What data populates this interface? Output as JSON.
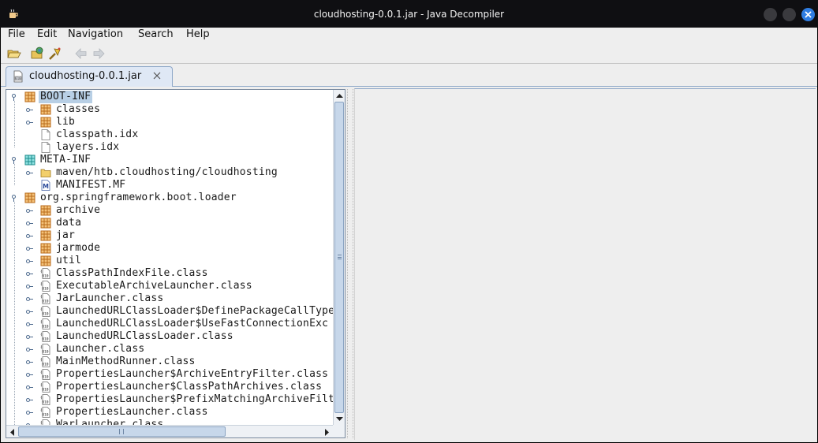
{
  "window": {
    "title": "cloudhosting-0.0.1.jar - Java Decompiler"
  },
  "menu": [
    "File",
    "Edit",
    "Navigation",
    "Search",
    "Help"
  ],
  "toolbar": {
    "icons": [
      "open-file-icon",
      "open-type-icon",
      "search-icon",
      "back-icon",
      "forward-icon"
    ]
  },
  "tab": {
    "label": "cloudhosting-0.0.1.jar"
  },
  "tree": [
    {
      "label": "BOOT-INF",
      "icon": "package",
      "depth": 0,
      "expander": "expanded",
      "selected": true
    },
    {
      "label": "classes",
      "icon": "package",
      "depth": 1,
      "expander": "collapsed"
    },
    {
      "label": "lib",
      "icon": "package",
      "depth": 1,
      "expander": "collapsed"
    },
    {
      "label": "classpath.idx",
      "icon": "file",
      "depth": 1,
      "expander": "none"
    },
    {
      "label": "layers.idx",
      "icon": "file",
      "depth": 1,
      "expander": "none"
    },
    {
      "label": "META-INF",
      "icon": "package-teal",
      "depth": 0,
      "expander": "expanded"
    },
    {
      "label": "maven/htb.cloudhosting/cloudhosting",
      "icon": "folder",
      "depth": 1,
      "expander": "collapsed"
    },
    {
      "label": "MANIFEST.MF",
      "icon": "manifest",
      "depth": 1,
      "expander": "none"
    },
    {
      "label": "org.springframework.boot.loader",
      "icon": "package",
      "depth": 0,
      "expander": "expanded"
    },
    {
      "label": "archive",
      "icon": "package",
      "depth": 1,
      "expander": "collapsed"
    },
    {
      "label": "data",
      "icon": "package",
      "depth": 1,
      "expander": "collapsed"
    },
    {
      "label": "jar",
      "icon": "package",
      "depth": 1,
      "expander": "collapsed"
    },
    {
      "label": "jarmode",
      "icon": "package",
      "depth": 1,
      "expander": "collapsed"
    },
    {
      "label": "util",
      "icon": "package",
      "depth": 1,
      "expander": "collapsed"
    },
    {
      "label": "ClassPathIndexFile.class",
      "icon": "class",
      "depth": 1,
      "expander": "collapsed"
    },
    {
      "label": "ExecutableArchiveLauncher.class",
      "icon": "class",
      "depth": 1,
      "expander": "collapsed"
    },
    {
      "label": "JarLauncher.class",
      "icon": "class",
      "depth": 1,
      "expander": "collapsed"
    },
    {
      "label": "LaunchedURLClassLoader$DefinePackageCallType",
      "icon": "class",
      "depth": 1,
      "expander": "collapsed"
    },
    {
      "label": "LaunchedURLClassLoader$UseFastConnectionExc",
      "icon": "class",
      "depth": 1,
      "expander": "collapsed"
    },
    {
      "label": "LaunchedURLClassLoader.class",
      "icon": "class",
      "depth": 1,
      "expander": "collapsed"
    },
    {
      "label": "Launcher.class",
      "icon": "class",
      "depth": 1,
      "expander": "collapsed"
    },
    {
      "label": "MainMethodRunner.class",
      "icon": "class",
      "depth": 1,
      "expander": "collapsed"
    },
    {
      "label": "PropertiesLauncher$ArchiveEntryFilter.class",
      "icon": "class",
      "depth": 1,
      "expander": "collapsed"
    },
    {
      "label": "PropertiesLauncher$ClassPathArchives.class",
      "icon": "class",
      "depth": 1,
      "expander": "collapsed"
    },
    {
      "label": "PropertiesLauncher$PrefixMatchingArchiveFilter.c",
      "icon": "class",
      "depth": 1,
      "expander": "collapsed"
    },
    {
      "label": "PropertiesLauncher.class",
      "icon": "class",
      "depth": 1,
      "expander": "collapsed"
    },
    {
      "label": "WarLauncher.class",
      "icon": "class",
      "depth": 1,
      "expander": "collapsed"
    }
  ]
}
